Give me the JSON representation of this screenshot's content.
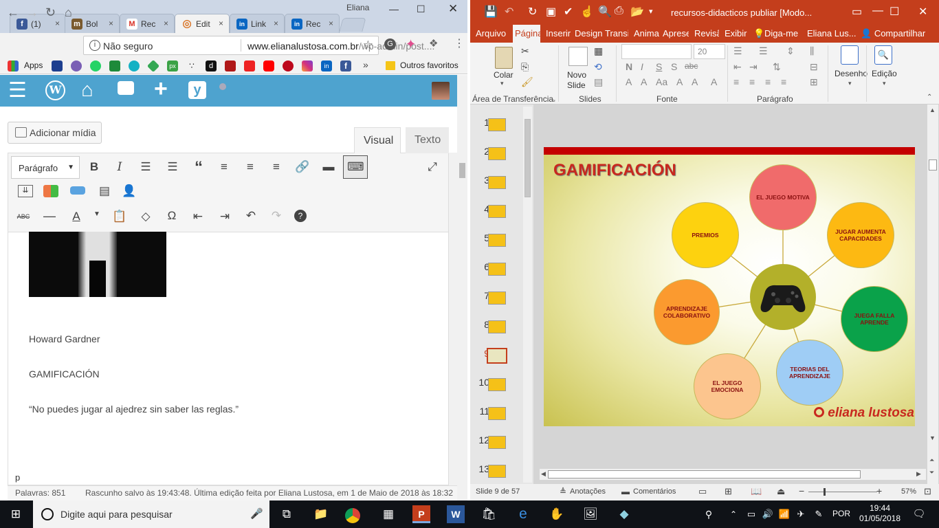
{
  "chrome": {
    "profile": "Eliana",
    "tabs": [
      {
        "label": "(1)",
        "icon": "facebook-icon",
        "color": "#3b5998",
        "glyph": "f"
      },
      {
        "label": "Bol",
        "icon": "mailchimp-icon",
        "color": "#7a5a2e",
        "glyph": "m"
      },
      {
        "label": "Rec",
        "icon": "gmail-icon",
        "color": "#d93025",
        "glyph": "M"
      },
      {
        "label": "Edit",
        "icon": "wordpress-loading-icon",
        "color": "#d9772b",
        "glyph": "◎"
      },
      {
        "label": "Link",
        "icon": "linkedin-icon",
        "color": "#0a66c2",
        "glyph": "in"
      },
      {
        "label": "Rec",
        "icon": "linkedin-icon",
        "color": "#0a66c2",
        "glyph": "in"
      }
    ],
    "address": {
      "security": "Não seguro",
      "url_host": "www.elianalustosa.com.br",
      "url_path": "/wp-admin/post...."
    },
    "bookmarks": {
      "apps": "Apps",
      "more": "»",
      "folder": "Outros favoritos"
    }
  },
  "wordpress": {
    "add_media": "Adicionar mídia",
    "tab_visual": "Visual",
    "tab_text": "Texto",
    "format": "Parágrafo",
    "content": {
      "line1": "Howard Gardner",
      "line2": "GAMIFICACIÓN",
      "line3": "“No puedes jugar al ajedrez sin saber las reglas.”"
    },
    "path": "p",
    "word_count": "Palavras: 851",
    "autosave": "Rascunho salvo às 19:43:48. Última edição feita por Eliana Lustosa, em 1 de Maio de 2018 às 18:32"
  },
  "powerpoint": {
    "title": "recursos-didacticos publiar [Modo...",
    "tabs": [
      "Arquivo",
      "Página",
      "Inserir",
      "Design",
      "Transiç",
      "Anima",
      "Apresen",
      "Revisã",
      "Exibir"
    ],
    "tell_me": "Diga-me",
    "user": "Eliana Lus...",
    "share": "Compartilhar",
    "ribbon": {
      "paste": "Colar",
      "new_slide": [
        "Novo",
        "Slide"
      ],
      "font_size": "20",
      "drawing": "Desenho",
      "editing": "Edição",
      "groups": [
        "Área de Transferência",
        "Slides",
        "Fonte",
        "Parágrafo"
      ]
    },
    "slides": [
      "1",
      "2",
      "3",
      "4",
      "5",
      "6",
      "7",
      "8",
      "9",
      "10",
      "11",
      "12",
      "13"
    ],
    "selected_slide": "9",
    "slide": {
      "title": "GAMIFICACIÓN",
      "nodes": [
        {
          "label": "EL JUEGO MOTIVA",
          "color": "#f06b6b"
        },
        {
          "label": "PREMIOS",
          "color": "#fdd20f"
        },
        {
          "label": "JUGAR AUMENTA CAPACIDADES",
          "color": "#fdb912"
        },
        {
          "label": "APRENDIZAJE COLABORATIVO",
          "color": "#fb9a2f"
        },
        {
          "label": "JUEGA FALLA APRENDE",
          "color": "#0aa24a"
        },
        {
          "label": "EL JUEGO EMOCIONA",
          "color": "#fcc58e"
        },
        {
          "label": "TEORIAS DEL APRENDIZAJE",
          "color": "#9fcdf5"
        }
      ],
      "hub_icon": "gamepad-icon",
      "logo": "eliana lustosa"
    },
    "status": {
      "slide": "Slide 9 de 57",
      "notes": "Anotações",
      "comments": "Comentários",
      "zoom": "57%"
    }
  },
  "taskbar": {
    "search": "Digite aqui para pesquisar",
    "lang": "POR",
    "time": "19:44",
    "date": "01/05/2018"
  }
}
